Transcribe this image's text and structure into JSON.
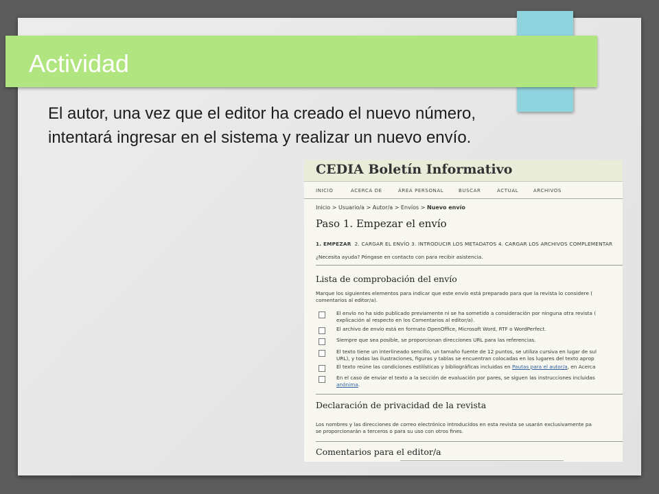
{
  "slide": {
    "title": "Actividad",
    "body": "El autor, una vez que el editor ha creado el nuevo número, intentará ingresar en el sistema y realizar un nuevo envío."
  },
  "screenshot": {
    "site_title": "CEDIA Boletín Informativo",
    "nav": [
      "INICIO",
      "ACERCA DE",
      "ÁREA PERSONAL",
      "BUSCAR",
      "ACTUAL",
      "ARCHIVOS"
    ],
    "breadcrumb": {
      "path": "Inicio > Usuario/a > Autor/a > Envíos > ",
      "current": "Nuevo envío"
    },
    "page_heading": "Paso 1. Empezar el envío",
    "steps": {
      "current": "1. EMPEZAR",
      "rest": "2. CARGAR EL ENVÍO  3. INTRODUCIR LOS METADATOS  4. CARGAR LOS ARCHIVOS COMPLEMENTAR"
    },
    "help_text": "¿Necesita ayuda? Póngase en contacto con para recibir asistencia.",
    "checklist": {
      "heading": "Lista de comprobación del envío",
      "intro": [
        "Marque los siguientes elementos para indicar que este envío está preparado para que la revista lo considere (",
        "comentarios al editor/a)."
      ],
      "items": [
        {
          "lines": [
            "El envío no ha sido publicado previamente ni se ha sometido a consideración por ninguna otra revista (",
            "explicación al respecto en los Comentarios al editor/a)."
          ]
        },
        {
          "lines": [
            "El archivo de envío está en formato OpenOffice, Microsoft Word, RTF o WordPerfect."
          ]
        },
        {
          "lines": [
            "Siempre que sea posible, se proporcionan direcciones URL para las referencias."
          ]
        },
        {
          "lines": [
            "El texto tiene un interlineado sencillo, un tamaño fuente de 12 puntos, se utiliza cursiva en lugar de sul",
            "URL), y todas las ilustraciones, figuras y tablas se encuentran colocadas en los lugares del texto aprop"
          ]
        },
        {
          "lines": [
            "El texto reúne las condiciones estilísticas y bibliográficas incluidas en "
          ],
          "link": "Pautas para el autor/a",
          "after": ", en Acerca"
        },
        {
          "lines": [
            "En el caso de enviar el texto a la sección de evaluación por pares, se siguen las instrucciones incluidas"
          ],
          "link2": "anónima",
          "after2": "."
        }
      ]
    },
    "privacy": {
      "heading": "Declaración de privacidad de la revista",
      "lines": [
        "Los nombres y las direcciones de correo electrónico introducidos en esta revista se usarán exclusivamente pa",
        "se proporcionarán a terceros o para su uso con otros fines."
      ]
    },
    "comments_heading": "Comentarios para el editor/a"
  }
}
